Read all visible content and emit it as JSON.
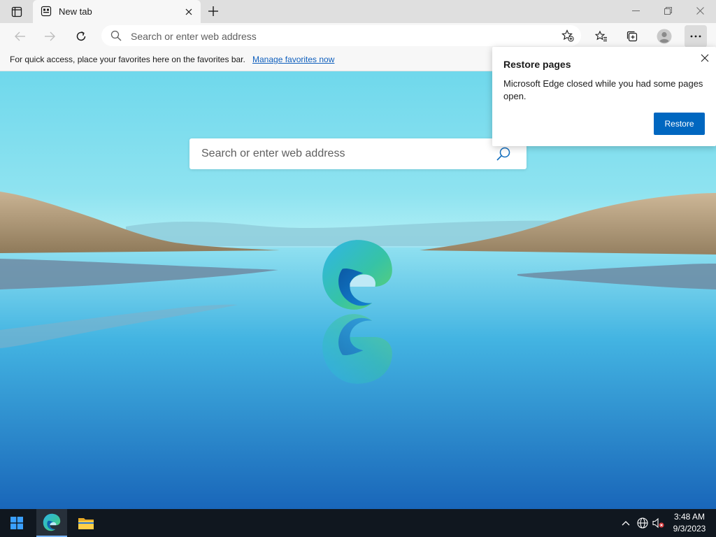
{
  "browser": {
    "tab": {
      "title": "New tab"
    },
    "address_bar": {
      "placeholder": "Search or enter web address"
    },
    "favorites_bar": {
      "hint": "For quick access, place your favorites here on the favorites bar.",
      "link": "Manage favorites now"
    },
    "icons": {
      "tab_actions": "tab-actions-icon",
      "back": "back-arrow-icon",
      "forward": "forward-arrow-icon",
      "refresh": "refresh-icon",
      "add_favorite": "star-plus-icon",
      "favorites": "favorites-icon",
      "collections": "collections-icon",
      "profile": "profile-icon",
      "menu": "more-icon"
    }
  },
  "new_tab_page": {
    "search": {
      "placeholder": "Search or enter web address"
    }
  },
  "restore_flyout": {
    "title": "Restore pages",
    "body": "Microsoft Edge closed while you had some pages open.",
    "button": "Restore"
  },
  "taskbar": {
    "clock": {
      "time": "3:48 AM",
      "date": "9/3/2023"
    }
  },
  "colors": {
    "accent": "#0067c0",
    "link": "#0f5fbd",
    "taskbar": "#10171f"
  }
}
